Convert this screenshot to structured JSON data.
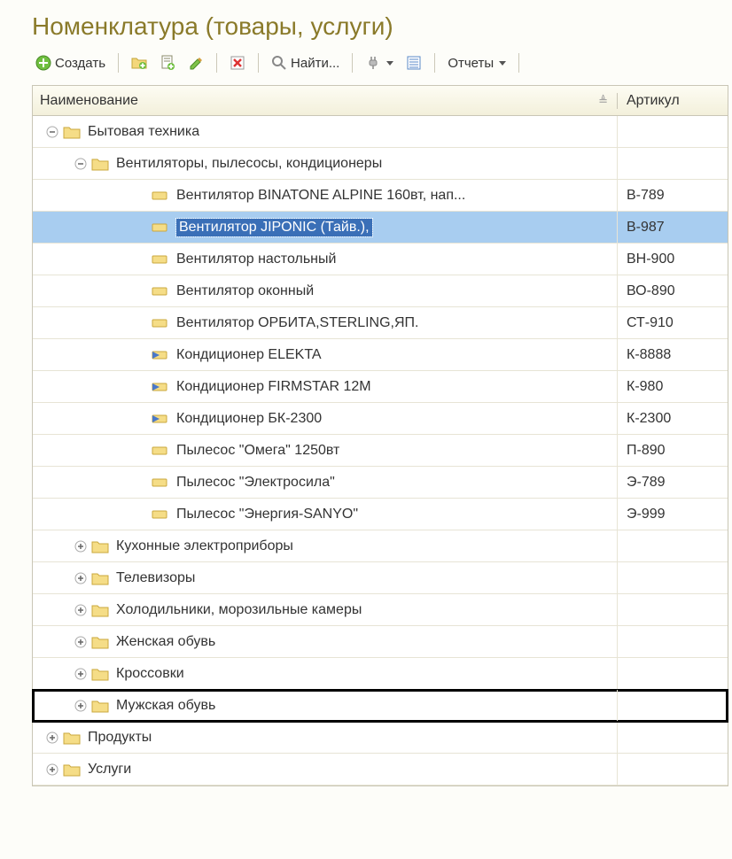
{
  "title": "Номенклатура (товары, услуги)",
  "toolbar": {
    "create": "Создать",
    "find": "Найти...",
    "reports": "Отчеты"
  },
  "headers": {
    "name": "Наименование",
    "article": "Артикул"
  },
  "rows": [
    {
      "indent": 1,
      "expander": "minus",
      "type": "folder",
      "label": "Бытовая техника",
      "article": "",
      "selected": false,
      "boxed": false
    },
    {
      "indent": 2,
      "expander": "minus",
      "type": "folder",
      "label": "Вентиляторы, пылесосы, кондиционеры",
      "article": "",
      "selected": false,
      "boxed": false
    },
    {
      "indent": 3,
      "expander": "none",
      "type": "item",
      "label": "Вентилятор BINATONE ALPINE 160вт, нап...",
      "article": "В-789",
      "selected": false,
      "boxed": false
    },
    {
      "indent": 3,
      "expander": "none",
      "type": "item",
      "label": "Вентилятор JIPONIC (Тайв.),",
      "article": "В-987",
      "selected": true,
      "boxed": false
    },
    {
      "indent": 3,
      "expander": "none",
      "type": "item",
      "label": "Вентилятор настольный",
      "article": "ВН-900",
      "selected": false,
      "boxed": false
    },
    {
      "indent": 3,
      "expander": "none",
      "type": "item",
      "label": "Вентилятор оконный",
      "article": "ВО-890",
      "selected": false,
      "boxed": false
    },
    {
      "indent": 3,
      "expander": "none",
      "type": "item",
      "label": "Вентилятор ОРБИТА,STERLING,ЯП.",
      "article": "СТ-910",
      "selected": false,
      "boxed": false
    },
    {
      "indent": 3,
      "expander": "none",
      "type": "item2",
      "label": "Кондиционер ELEKTA",
      "article": "К-8888",
      "selected": false,
      "boxed": false
    },
    {
      "indent": 3,
      "expander": "none",
      "type": "item2",
      "label": "Кондиционер FIRMSTAR 12M",
      "article": "К-980",
      "selected": false,
      "boxed": false
    },
    {
      "indent": 3,
      "expander": "none",
      "type": "item2",
      "label": "Кондиционер БК-2300",
      "article": "К-2300",
      "selected": false,
      "boxed": false
    },
    {
      "indent": 3,
      "expander": "none",
      "type": "item",
      "label": "Пылесос \"Омега\" 1250вт",
      "article": "П-890",
      "selected": false,
      "boxed": false
    },
    {
      "indent": 3,
      "expander": "none",
      "type": "item",
      "label": "Пылесос \"Электросила\"",
      "article": "Э-789",
      "selected": false,
      "boxed": false
    },
    {
      "indent": 3,
      "expander": "none",
      "type": "item",
      "label": "Пылесос \"Энергия-SANYO\"",
      "article": "Э-999",
      "selected": false,
      "boxed": false
    },
    {
      "indent": 2,
      "expander": "plus",
      "type": "folder",
      "label": "Кухонные электроприборы",
      "article": "",
      "selected": false,
      "boxed": false
    },
    {
      "indent": 2,
      "expander": "plus",
      "type": "folder",
      "label": "Телевизоры",
      "article": "",
      "selected": false,
      "boxed": false
    },
    {
      "indent": 2,
      "expander": "plus",
      "type": "folder",
      "label": "Холодильники, морозильные камеры",
      "article": "",
      "selected": false,
      "boxed": false
    },
    {
      "indent": 2,
      "expander": "plus",
      "type": "folder",
      "label": "Женская обувь",
      "article": "",
      "selected": false,
      "boxed": false
    },
    {
      "indent": 2,
      "expander": "plus",
      "type": "folder",
      "label": "Кроссовки",
      "article": "",
      "selected": false,
      "boxed": false
    },
    {
      "indent": 2,
      "expander": "plus",
      "type": "folder",
      "label": "Мужская обувь",
      "article": "",
      "selected": false,
      "boxed": true
    },
    {
      "indent": 1,
      "expander": "plus",
      "type": "folder",
      "label": "Продукты",
      "article": "",
      "selected": false,
      "boxed": false
    },
    {
      "indent": 1,
      "expander": "plus",
      "type": "folder",
      "label": "Услуги",
      "article": "",
      "selected": false,
      "boxed": false
    }
  ]
}
